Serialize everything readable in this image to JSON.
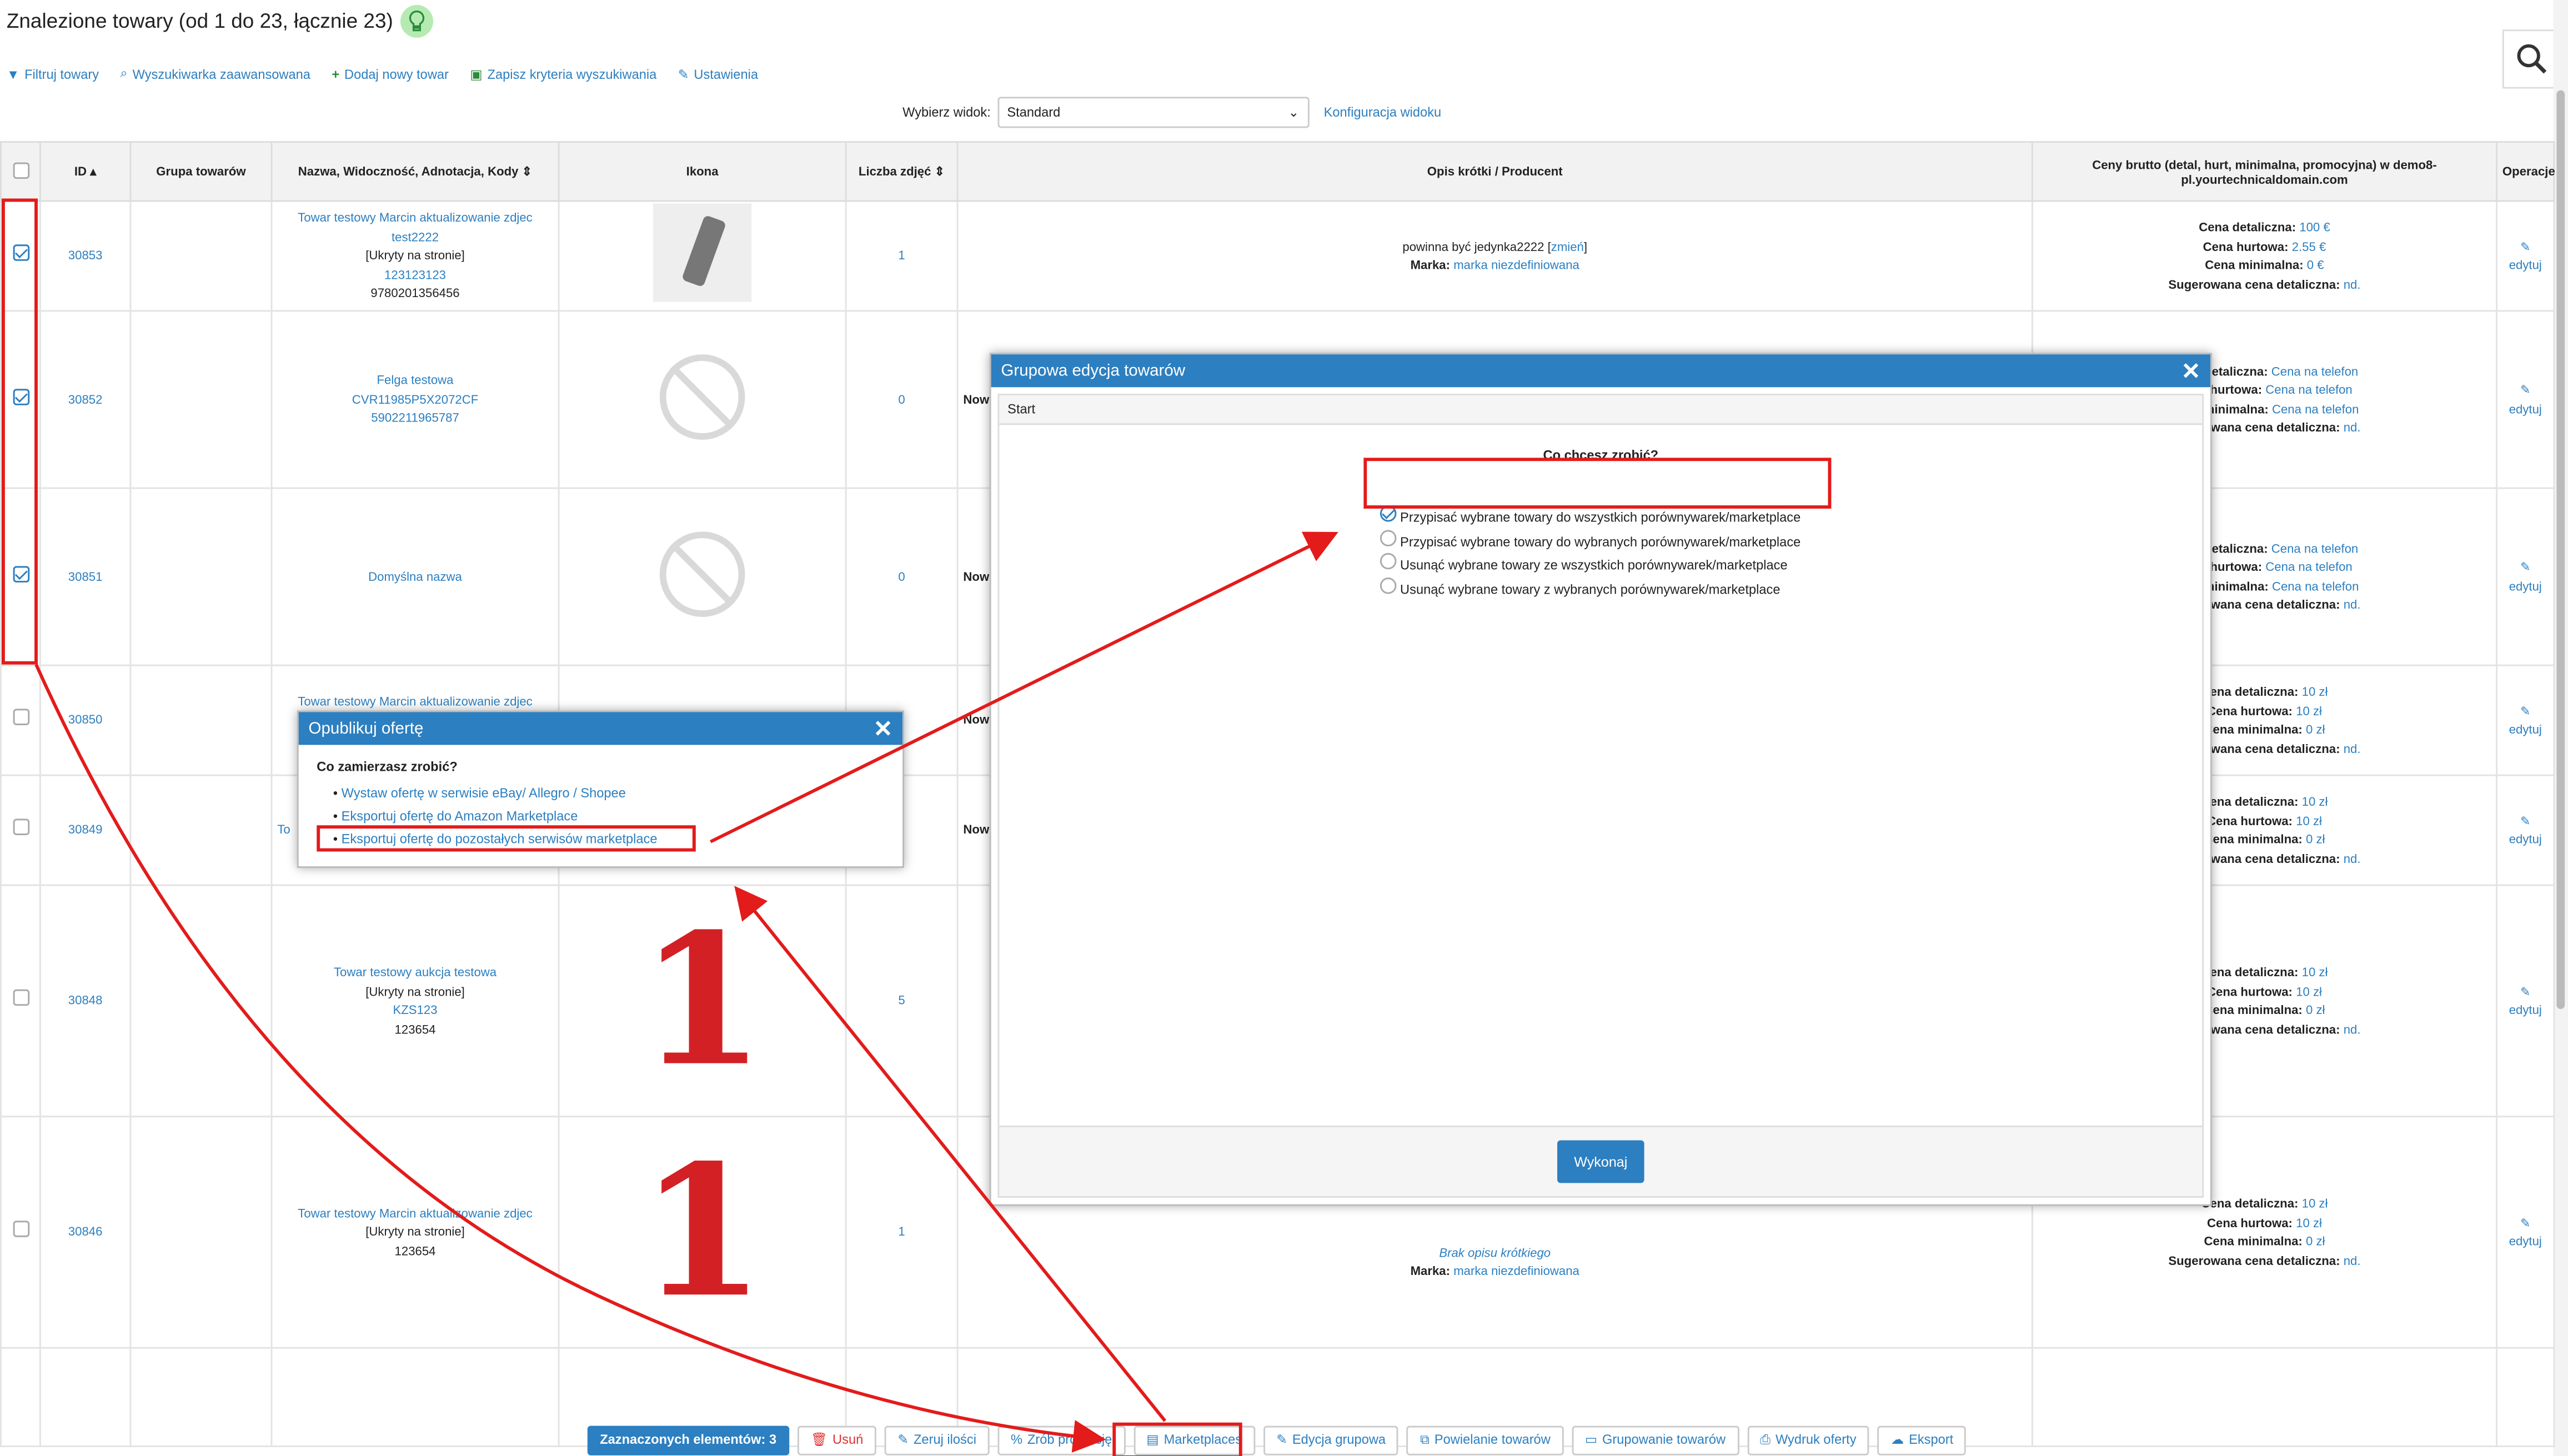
{
  "page": {
    "title": "Znalezione towary (od 1 do 23, łącznie 23)"
  },
  "toolbar": {
    "filter": "Filtruj towary",
    "advanced": "Wyszukiwarka zaawansowana",
    "add": "Dodaj nowy towar",
    "save": "Zapisz kryteria wyszukiwania",
    "settings": "Ustawienia"
  },
  "view": {
    "label": "Wybierz widok:",
    "selected": "Standard",
    "config": "Konfiguracja widoku"
  },
  "table": {
    "headers": {
      "id": "ID",
      "group": "Grupa towarów",
      "name": "Nazwa, Widoczność, Adnotacja, Kody",
      "icon": "Ikona",
      "photos": "Liczba zdjęć",
      "desc": "Opis krótki / Producent",
      "prices": "Ceny brutto (detal, hurt, minimalna, promocyjna) w demo8-pl.yourtechnicaldomain.com",
      "ops": "Operacje"
    }
  },
  "rows": [
    {
      "id": "30853",
      "name": "Towar testowy Marcin aktualizowanie zdjec test2222",
      "vis": "[Ukryty na stronie]",
      "code1": "123123123",
      "code2": "9780201356456",
      "photos": "1",
      "desc": "powinna być jedynka2222",
      "change": "zmień",
      "brand_lbl": "Marka:",
      "brand": "marka niezdefiniowana",
      "p1l": "Cena detaliczna:",
      "p1": "100 €",
      "p2l": "Cena hurtowa:",
      "p2": "2.55 €",
      "p3l": "Cena minimalna:",
      "p3": "0 €",
      "p4l": "Sugerowana cena detaliczna:",
      "p4": "nd.",
      "edit": "edytuj"
    },
    {
      "id": "30852",
      "name": "Felga testowa",
      "code1": "CVR11985P5X2072CF",
      "code2": "5902211965787",
      "photos": "0",
      "desc": "Now",
      "p1l": "Cena detaliczna:",
      "p1": "Cena na telefon",
      "p2l": "Cena hurtowa:",
      "p2": "Cena na telefon",
      "p3l": "Cena minimalna:",
      "p3": "Cena na telefon",
      "p4l": "Sugerowana cena detaliczna:",
      "p4": "nd.",
      "edit": "edytuj"
    },
    {
      "id": "30851",
      "name": "Domyślna nazwa",
      "photos": "0",
      "desc": "Now",
      "p1l": "Cena detaliczna:",
      "p1": "Cena na telefon",
      "p2l": "Cena hurtowa:",
      "p2": "Cena na telefon",
      "p3l": "Cena minimalna:",
      "p3": "Cena na telefon",
      "p4l": "Sugerowana cena detaliczna:",
      "p4": "nd.",
      "edit": "edytuj"
    },
    {
      "id": "30850",
      "name": "Towar testowy Marcin aktualizowanie zdjec",
      "desc": "Now",
      "p1l": "Cena detaliczna:",
      "p1": "10 zł",
      "p2l": "Cena hurtowa:",
      "p2": "10 zł",
      "p3l": "Cena minimalna:",
      "p3": "0 zł",
      "p4l": "Sugerowana cena detaliczna:",
      "p4": "nd.",
      "edit": "edytuj"
    },
    {
      "id": "30849",
      "name": "To",
      "desc": "Now",
      "p1l": "Cena detaliczna:",
      "p1": "10 zł",
      "p2l": "Cena hurtowa:",
      "p2": "10 zł",
      "p3l": "Cena minimalna:",
      "p3": "0 zł",
      "p4l": "Sugerowana cena detaliczna:",
      "p4": "nd.",
      "edit": "edytuj"
    },
    {
      "id": "30848",
      "name": "Towar testowy aukcja testowa",
      "vis": "[Ukryty na stronie]",
      "code1": "KZS123",
      "code2": "123654",
      "photos": "5",
      "p1l": "Cena detaliczna:",
      "p1": "10 zł",
      "p2l": "Cena hurtowa:",
      "p2": "10 zł",
      "p3l": "Cena minimalna:",
      "p3": "0 zł",
      "p4l": "Sugerowana cena detaliczna:",
      "p4": "nd.",
      "edit": "edytuj",
      "icon": "1"
    },
    {
      "id": "30846",
      "name": "Towar testowy Marcin aktualizowanie zdjec",
      "vis": "[Ukryty na stronie]",
      "code2": "123654",
      "photos": "1",
      "desc": "Brak opisu krótkiego",
      "brand_lbl": "Marka:",
      "brand": "marka niezdefiniowana",
      "p1l": "Cena detaliczna:",
      "p1": "10 zł",
      "p2l": "Cena hurtowa:",
      "p2": "10 zł",
      "p3l": "Cena minimalna:",
      "p3": "0 zł",
      "p4l": "Sugerowana cena detaliczna:",
      "p4": "nd.",
      "edit": "edytuj",
      "icon": "1"
    }
  ],
  "publish": {
    "title": "Opublikuj ofertę",
    "question": "Co zamierzasz zrobić?",
    "opt1": "Wystaw ofertę w serwisie eBay/ Allegro / Shopee",
    "opt2": "Eksportuj ofertę do Amazon Marketplace",
    "opt3": "Eksportuj ofertę do pozostałych serwisów marketplace"
  },
  "group_edit": {
    "title": "Grupowa edycja towarów",
    "breadcrumb": "Start",
    "question": "Co chcesz zrobić?",
    "opt1": "Przypisać wybrane towary do wszystkich porównywarek/marketplace",
    "opt2": "Przypisać wybrane towary do wybranych porównywarek/marketplace",
    "opt3": "Usunąć wybrane towary ze wszystkich porównywarek/marketplace",
    "opt4": "Usunąć wybrane towary z wybranych porównywarek/marketplace",
    "submit": "Wykonaj"
  },
  "bottom": {
    "selected": "Zaznaczonych elementów: 3",
    "delete": "Usuń",
    "zero": "Zeruj ilości",
    "promo": "Zrób promocję",
    "marketplaces": "Marketplaces",
    "group_edit": "Edycja grupowa",
    "duplicate": "Powielanie towarów",
    "grouping": "Grupowanie towarów",
    "print": "Wydruk oferty",
    "export": "Eksport"
  },
  "colors": {
    "accent": "#2c7fc0",
    "annotation": "#e31b1b"
  }
}
